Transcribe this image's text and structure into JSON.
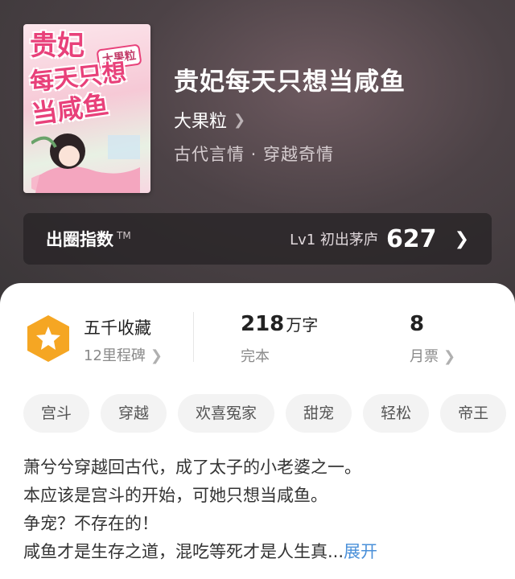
{
  "book": {
    "title": "贵妃每天只想当咸鱼",
    "author": "大果粒",
    "genre": "古代言情 · 穿越奇情",
    "cover": {
      "line1": "贵妃",
      "line2": "每天只想",
      "line3": "当咸鱼",
      "author_tag": "大果粒"
    }
  },
  "index_bar": {
    "label": "出圈指数",
    "tm": "TM",
    "level_text": "Lv1 初出茅庐",
    "score": "627"
  },
  "stats": {
    "collection_title": "五千收藏",
    "collection_sub": "12里程碑",
    "words_num": "218",
    "words_unit": "万字",
    "status": "完本",
    "monthly_tickets": "8",
    "monthly_label": "月票"
  },
  "tags": [
    "宫斗",
    "穿越",
    "欢喜冤家",
    "甜宠",
    "轻松",
    "帝王"
  ],
  "description": {
    "lines": [
      "萧兮兮穿越回古代，成了太子的小老婆之一。",
      "本应该是宫斗的开始，可她只想当咸鱼。",
      "争宠？不存在的！",
      "咸鱼才是生存之道，混吃等死才是人生真..."
    ],
    "expand_label": "展开"
  },
  "colors": {
    "accent_link": "#4a90d9",
    "badge": "#f5a623",
    "cover_text": "#e8417a"
  },
  "icons": [
    "chevron-right-icon",
    "star-badge-icon"
  ]
}
